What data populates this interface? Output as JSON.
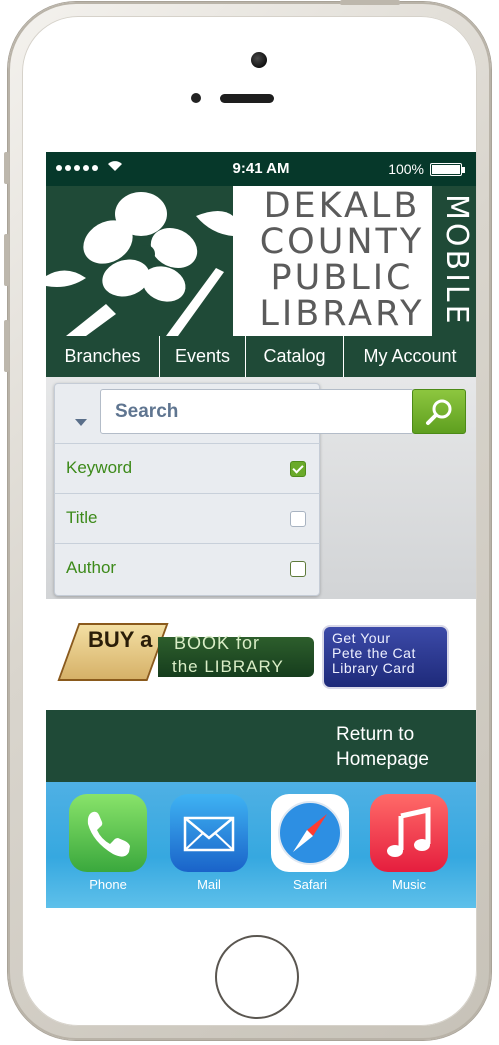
{
  "status_bar": {
    "time": "9:41 AM",
    "battery": "100%"
  },
  "header": {
    "library_name": [
      "DEKALB",
      "COUNTY",
      "PUBLIC",
      "LIBRARY"
    ],
    "mobile": "MOBILE"
  },
  "nav": {
    "items": [
      {
        "label": "Branches"
      },
      {
        "label": "Events"
      },
      {
        "label": "Catalog"
      },
      {
        "label": "My Account"
      }
    ]
  },
  "search": {
    "placeholder": "Search",
    "options": [
      {
        "label": "Keyword",
        "checked": true
      },
      {
        "label": "Title",
        "checked": false
      },
      {
        "label": "Author",
        "checked": false
      }
    ]
  },
  "promo": {
    "buy_a": "BUY a",
    "book_for": "BOOK for",
    "the_library": "the LIBRARY",
    "pete_line1": "Get Your",
    "pete_line2": "Pete the Cat",
    "pete_line3": "Library Card"
  },
  "footer": {
    "return_line1": "Return to",
    "return_line2": "Homepage"
  },
  "dock": {
    "apps": [
      {
        "label": "Phone",
        "icon": "phone-icon"
      },
      {
        "label": "Mail",
        "icon": "mail-icon"
      },
      {
        "label": "Safari",
        "icon": "safari-icon"
      },
      {
        "label": "Music",
        "icon": "music-icon"
      }
    ]
  },
  "colors": {
    "brand_green": "#1f4a37",
    "accent_green": "#6aaa2a",
    "search_text": "#5f7590"
  }
}
